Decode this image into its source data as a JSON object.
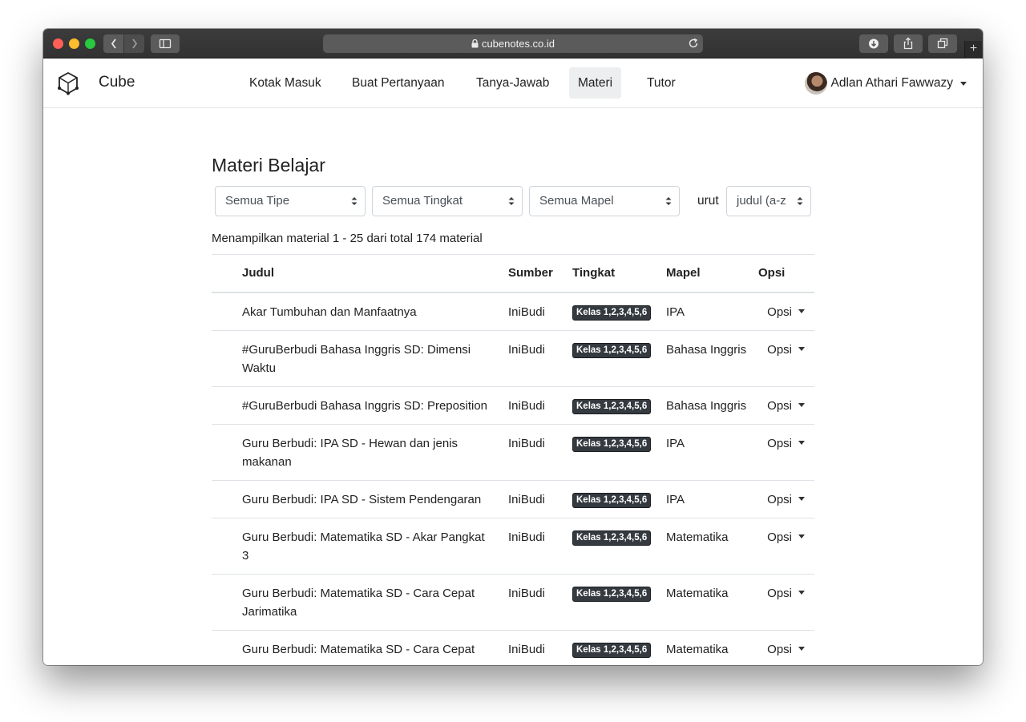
{
  "browser": {
    "url": "cubenotes.co.id"
  },
  "nav": {
    "brand": "Cube",
    "items": [
      {
        "label": "Kotak Masuk"
      },
      {
        "label": "Buat Pertanyaan"
      },
      {
        "label": "Tanya-Jawab"
      },
      {
        "label": "Materi",
        "active": true
      },
      {
        "label": "Tutor"
      }
    ],
    "user_name": "Adlan Athari Fawwazy"
  },
  "page": {
    "title": "Materi Belajar",
    "filters": {
      "tipe": "Semua Tipe",
      "tingkat": "Semua Tingkat",
      "mapel": "Semua Mapel",
      "sort_label": "urut",
      "sort": "judul (a-z"
    },
    "summary": {
      "prefix": "Menampilkan material",
      "range": "1 - 25",
      "middle": "dari total",
      "total": "174",
      "suffix": "material"
    }
  },
  "table": {
    "headers": {
      "judul": "Judul",
      "sumber": "Sumber",
      "tingkat": "Tingkat",
      "mapel": "Mapel",
      "opsi": "Opsi"
    },
    "rows": [
      {
        "judul": "Akar Tumbuhan dan Manfaatnya",
        "sumber": "IniBudi",
        "tingkat": "Kelas 1,2,3,4,5,6",
        "mapel": "IPA",
        "opsi": "Opsi"
      },
      {
        "judul": "#GuruBerbudi Bahasa Inggris SD: Dimensi Waktu",
        "sumber": "IniBudi",
        "tingkat": "Kelas 1,2,3,4,5,6",
        "mapel": "Bahasa Inggris",
        "opsi": "Opsi"
      },
      {
        "judul": "#GuruBerbudi Bahasa Inggris SD: Preposition",
        "sumber": "IniBudi",
        "tingkat": "Kelas 1,2,3,4,5,6",
        "mapel": "Bahasa Inggris",
        "opsi": "Opsi"
      },
      {
        "judul": "Guru Berbudi: IPA SD - Hewan dan jenis makanan",
        "sumber": "IniBudi",
        "tingkat": "Kelas 1,2,3,4,5,6",
        "mapel": "IPA",
        "opsi": "Opsi"
      },
      {
        "judul": "Guru Berbudi: IPA SD - Sistem Pendengaran",
        "sumber": "IniBudi",
        "tingkat": "Kelas 1,2,3,4,5,6",
        "mapel": "IPA",
        "opsi": "Opsi"
      },
      {
        "judul": "Guru Berbudi: Matematika SD - Akar Pangkat 3",
        "sumber": "IniBudi",
        "tingkat": "Kelas 1,2,3,4,5,6",
        "mapel": "Matematika",
        "opsi": "Opsi"
      },
      {
        "judul": "Guru Berbudi: Matematika SD - Cara Cepat Jarimatika",
        "sumber": "IniBudi",
        "tingkat": "Kelas 1,2,3,4,5,6",
        "mapel": "Matematika",
        "opsi": "Opsi"
      },
      {
        "judul": "Guru Berbudi: Matematika SD - Cara Cepat",
        "sumber": "IniBudi",
        "tingkat": "Kelas 1,2,3,4,5,6",
        "mapel": "Matematika",
        "opsi": "Opsi"
      }
    ]
  }
}
